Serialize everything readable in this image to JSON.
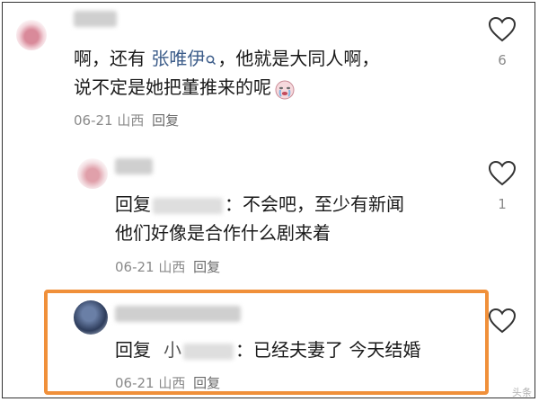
{
  "comments": [
    {
      "text_line1_prefix": "啊，还有 ",
      "mention": "张唯伊",
      "text_line1_suffix": "，他就是大同人啊，",
      "text_line2": "说不定是她把董推来的呢",
      "emoji": "crying-face-emoji",
      "date": "06-21",
      "location": "山西",
      "reply_label": "回复",
      "likes": "6"
    },
    {
      "reply_prefix": "回复",
      "text_after_name": "：不会吧，至少有新闻",
      "text_line2": "他们好像是合作什么剧来着",
      "date": "06-21",
      "location": "山西",
      "reply_label": "回复",
      "likes": "1"
    },
    {
      "reply_prefix": "回复",
      "name_visible": "小",
      "text_after_name": "：已经夫妻了 今天结婚",
      "date": "06-21",
      "location": "山西",
      "reply_label": "回复",
      "likes": ""
    }
  ],
  "icons": {
    "like": "heart-outline-icon",
    "mention_search": "search-icon"
  },
  "colors": {
    "highlight": "#f0903a",
    "link": "#3d5d8a",
    "meta": "#8a8a8a"
  },
  "watermark": "头条"
}
